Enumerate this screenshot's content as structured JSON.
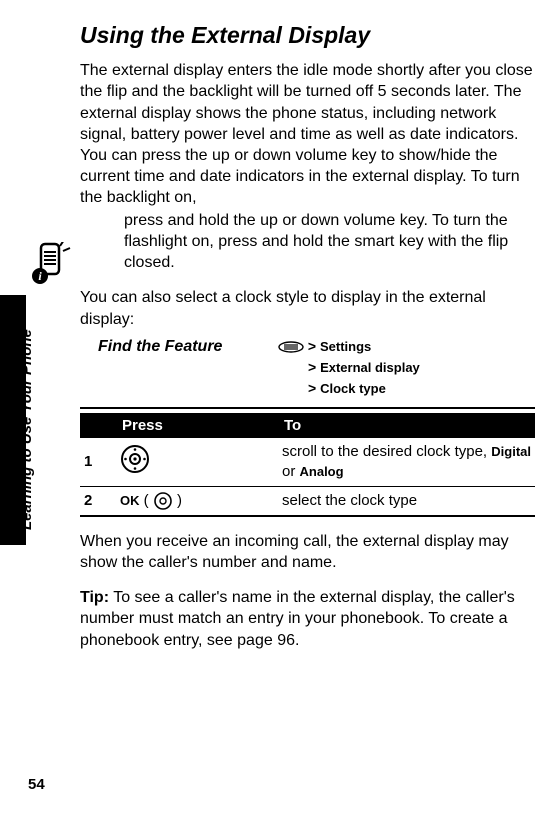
{
  "page": {
    "title": "Using the External Display",
    "para1_part1": "The external display enters the idle mode shortly after you close the flip and the backlight will be turned off 5 seconds later. The external display shows the phone status, including network signal, battery power level and time as well as date indicators. You can press the up or down volume key to show/hide the current time and date indicators in the external display. To turn the backlight on,",
    "para1_part2": "press and hold the up or down volume key. To turn the flashlight on, press and hold the smart key with the flip closed.",
    "para2": "You can also select a clock style to display in the external display:",
    "feature_label": "Find the Feature",
    "menu_path": {
      "line1_gt": ">",
      "line1": "Settings",
      "line2_gt": ">",
      "line2": "External display",
      "line3_gt": ">",
      "line3": "Clock type"
    },
    "table": {
      "head_press": "Press",
      "head_to": "To",
      "rows": [
        {
          "num": "1",
          "press_icon": "nav-disc",
          "to_plain_a": "scroll to the desired clock type, ",
          "to_bold_a": "Digital",
          "to_plain_b": " or ",
          "to_bold_b": "Analog"
        },
        {
          "num": "2",
          "press_label": "OK",
          "press_paren_open": " ( ",
          "press_paren_close": " )",
          "to_plain_a": "select the clock type"
        }
      ]
    },
    "para3": "When you receive an incoming call, the external display may show the caller's number and name.",
    "tip_label": "Tip:",
    "tip_text": " To see a caller's name in the external display, the caller's number must match an entry in your phonebook. To create a phonebook entry, see page 96.",
    "spine": "Learning to Use Your Phone",
    "page_number": "54"
  }
}
